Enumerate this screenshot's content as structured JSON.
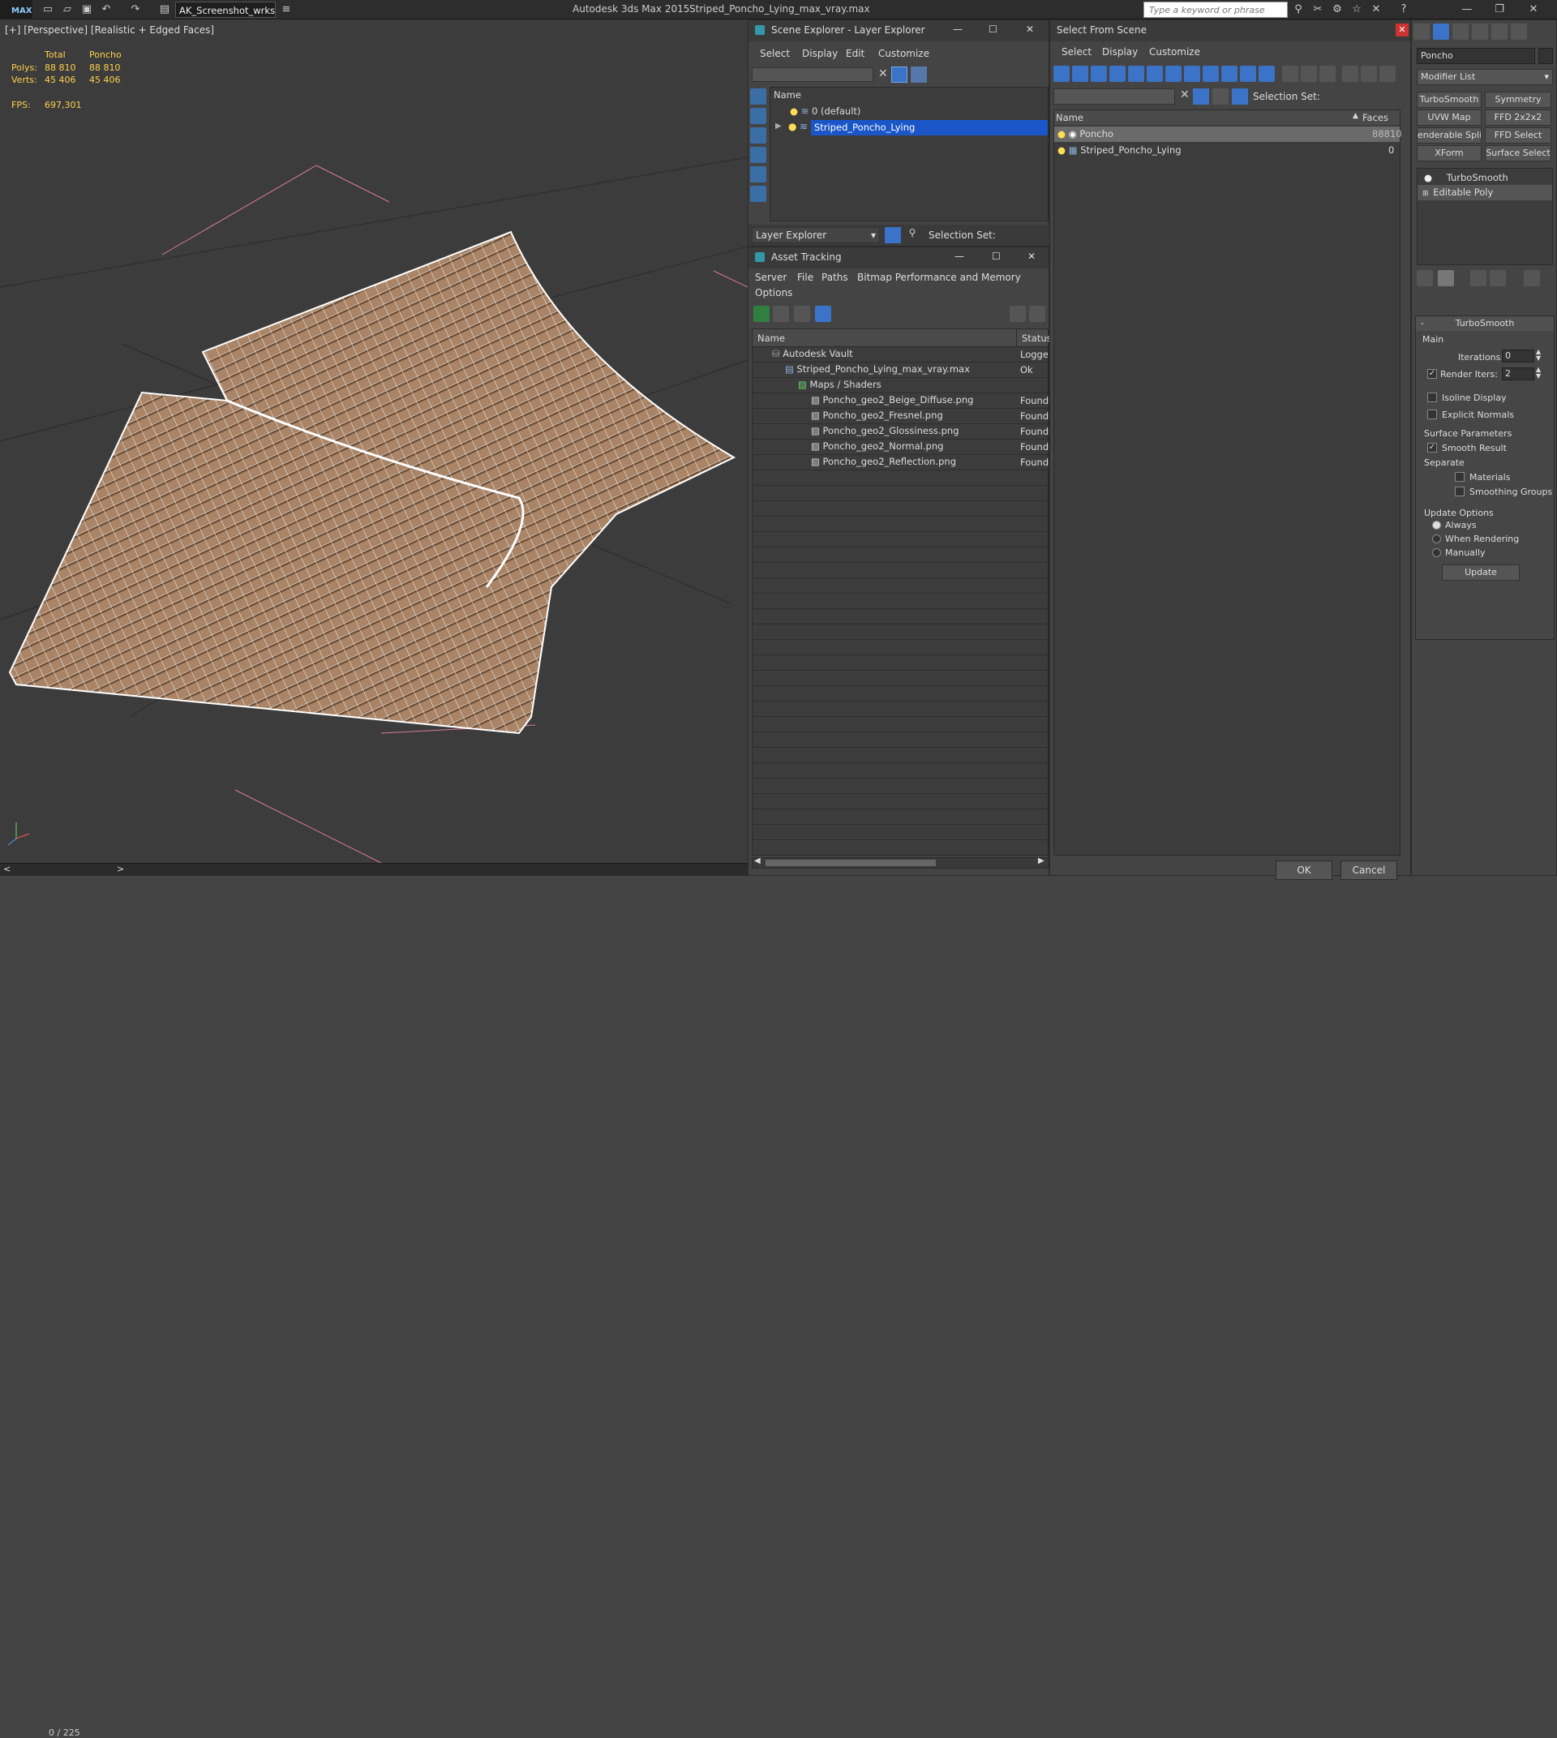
{
  "titlebar": {
    "logo": "MAX",
    "workspace": "AK_Screenshot_wrksp",
    "app_title": "Autodesk 3ds Max  2015",
    "doc_title": "Striped_Poncho_Lying_max_vray.max",
    "search_placeholder": "Type a keyword or phrase"
  },
  "viewport": {
    "label": "[+] [Perspective] [Realistic + Edged Faces]",
    "stats_header_total": "Total",
    "stats_header_object": "Poncho",
    "polys_label": "Polys:",
    "polys_total": "88 810",
    "polys_object": "88 810",
    "verts_label": "Verts:",
    "verts_total": "45 406",
    "verts_object": "45 406",
    "fps_label": "FPS:",
    "fps_value": "697,301"
  },
  "timeslider": {
    "frame": "0 / 225",
    "prev": "<",
    "next": ">"
  },
  "scene_explorer": {
    "title": "Scene Explorer - Layer Explorer",
    "menu": [
      "Select",
      "Display",
      "Edit",
      "Customize"
    ],
    "column_name": "Name",
    "rows": [
      "0 (default)",
      "Striped_Poncho_Lying"
    ],
    "footer_mode": "Layer Explorer",
    "selection_set_label": "Selection Set:"
  },
  "asset_tracking": {
    "title": "Asset Tracking",
    "menu": [
      "Server",
      "File",
      "Paths",
      "Bitmap Performance and Memory",
      "Options"
    ],
    "col_name": "Name",
    "col_status": "Status",
    "rows": [
      {
        "name": "Autodesk Vault",
        "status": "Logged"
      },
      {
        "name": "Striped_Poncho_Lying_max_vray.max",
        "status": "Ok"
      },
      {
        "name": "Maps / Shaders",
        "status": ""
      },
      {
        "name": "Poncho_geo2_Beige_Diffuse.png",
        "status": "Found"
      },
      {
        "name": "Poncho_geo2_Fresnel.png",
        "status": "Found"
      },
      {
        "name": "Poncho_geo2_Glossiness.png",
        "status": "Found"
      },
      {
        "name": "Poncho_geo2_Normal.png",
        "status": "Found"
      },
      {
        "name": "Poncho_geo2_Reflection.png",
        "status": "Found"
      }
    ]
  },
  "select_from_scene": {
    "title": "Select From Scene",
    "menu": [
      "Select",
      "Display",
      "Customize"
    ],
    "selection_set_label": "Selection Set:",
    "col_name": "Name",
    "col_faces": "Faces",
    "rows": [
      {
        "name": "Poncho",
        "faces": "88810"
      },
      {
        "name": "Striped_Poncho_Lying",
        "faces": "0"
      }
    ],
    "ok": "OK",
    "cancel": "Cancel"
  },
  "command_panel": {
    "object_name": "Poncho",
    "modifier_list": "Modifier List",
    "buttons": [
      "TurboSmooth",
      "Symmetry",
      "UVW Map",
      "FFD 2x2x2",
      "enderable Splir",
      "FFD Select",
      "XForm",
      "Surface Select"
    ],
    "stack": [
      "TurboSmooth",
      "Editable Poly"
    ],
    "rollout_title": "TurboSmooth",
    "main_label": "Main",
    "iterations_label": "Iterations:",
    "iterations_value": "0",
    "render_iters_label": "Render Iters:",
    "render_iters_value": "2",
    "isoline": "Isoline Display",
    "explicit_normals": "Explicit Normals",
    "surface_params": "Surface Parameters",
    "smooth_result": "Smooth Result",
    "separate": "Separate",
    "materials": "Materials",
    "smoothing_groups": "Smoothing Groups",
    "update_options": "Update Options",
    "always": "Always",
    "when_rendering": "When Rendering",
    "manually": "Manually",
    "update": "Update"
  },
  "colors": {
    "selection": "#1a56c8",
    "stats": "#ffd24d",
    "fabric": "#a98466"
  }
}
